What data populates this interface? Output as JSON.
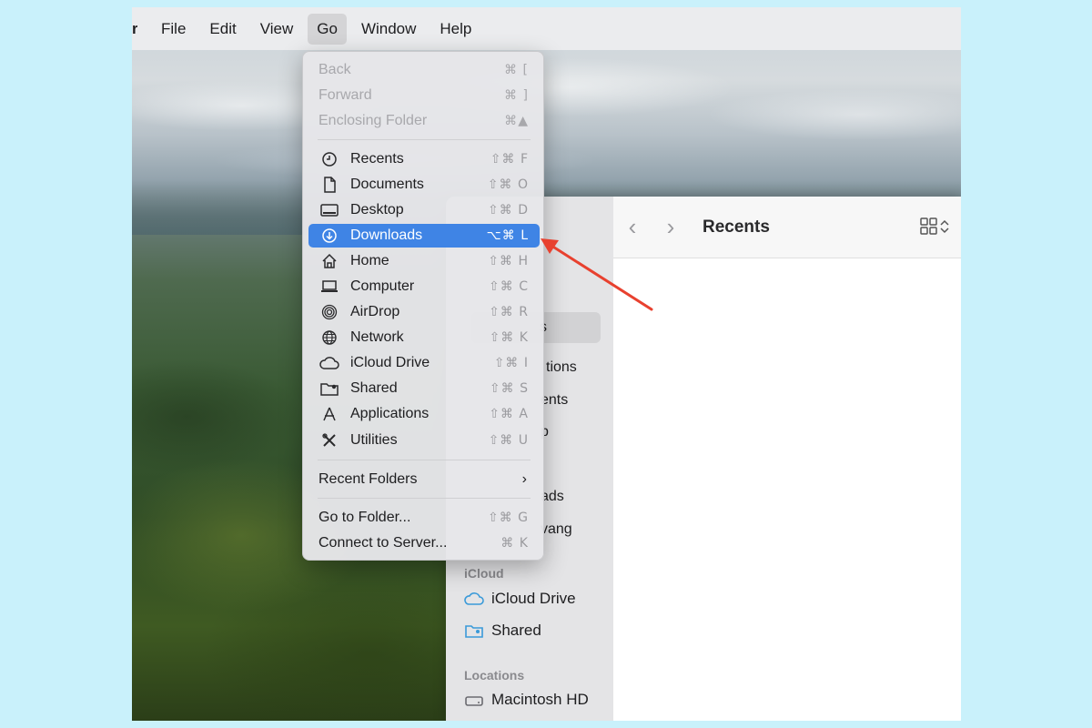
{
  "menubar": {
    "app_fragment": "r",
    "items": [
      "File",
      "Edit",
      "View",
      "Go",
      "Window",
      "Help"
    ]
  },
  "go_menu": {
    "nav": [
      {
        "label": "Back",
        "shortcut": "⌘ ["
      },
      {
        "label": "Forward",
        "shortcut": "⌘ ]"
      },
      {
        "label": "Enclosing Folder",
        "shortcut": "⌘▲"
      }
    ],
    "places": [
      {
        "label": "Recents",
        "shortcut": "⇧⌘ F",
        "icon": "clock-icon"
      },
      {
        "label": "Documents",
        "shortcut": "⇧⌘ O",
        "icon": "document-icon"
      },
      {
        "label": "Desktop",
        "shortcut": "⇧⌘ D",
        "icon": "desktop-icon"
      },
      {
        "label": "Downloads",
        "shortcut": "⌥⌘ L",
        "icon": "download-icon"
      },
      {
        "label": "Home",
        "shortcut": "⇧⌘ H",
        "icon": "home-icon"
      },
      {
        "label": "Computer",
        "shortcut": "⇧⌘ C",
        "icon": "laptop-icon"
      },
      {
        "label": "AirDrop",
        "shortcut": "⇧⌘ R",
        "icon": "airdrop-icon"
      },
      {
        "label": "Network",
        "shortcut": "⇧⌘ K",
        "icon": "globe-icon"
      },
      {
        "label": "iCloud Drive",
        "shortcut": "⇧⌘ I",
        "icon": "cloud-icon"
      },
      {
        "label": "Shared",
        "shortcut": "⇧⌘ S",
        "icon": "shared-folder-icon"
      },
      {
        "label": "Applications",
        "shortcut": "⇧⌘ A",
        "icon": "applications-icon"
      },
      {
        "label": "Utilities",
        "shortcut": "⇧⌘ U",
        "icon": "utilities-icon"
      }
    ],
    "recent_folders": "Recent Folders",
    "go_to_folder": {
      "label": "Go to Folder...",
      "shortcut": "⇧⌘ G"
    },
    "connect_server": {
      "label": "Connect to Server...",
      "shortcut": "⌘ K"
    }
  },
  "finder": {
    "title": "Recents",
    "sidebar_fragments": [
      "s",
      "tions",
      "ents",
      "p",
      "ads",
      "vang"
    ],
    "icloud_header": "iCloud",
    "icloud_items": [
      "iCloud Drive",
      "Shared"
    ],
    "locations_header": "Locations",
    "locations_items": [
      "Macintosh HD"
    ]
  },
  "colors": {
    "highlight": "#3f84e5",
    "annotation_arrow": "#e8412f",
    "page_background": "#c9f1fb"
  }
}
